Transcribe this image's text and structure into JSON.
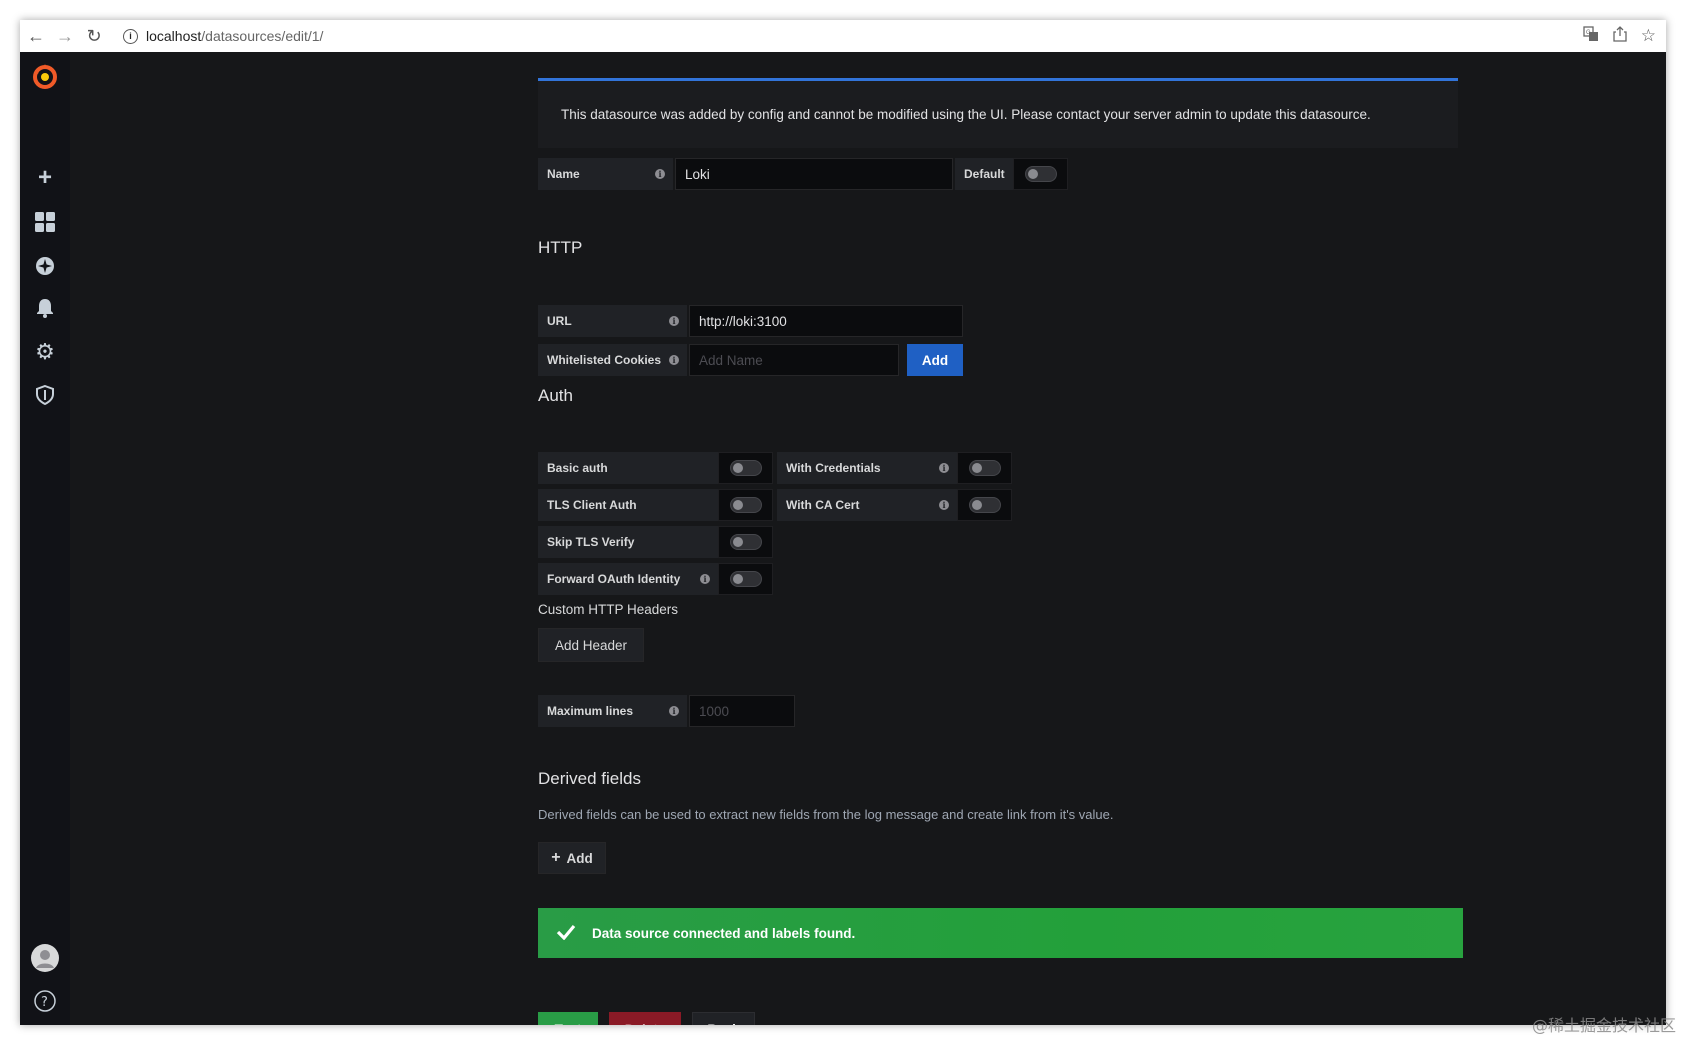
{
  "browser": {
    "url_host": "localhost",
    "url_path": "/datasources/edit/1/"
  },
  "alert_info": "This datasource was added by config and cannot be modified using the UI. Please contact your server admin to update this datasource.",
  "name_row": {
    "label": "Name",
    "value": "Loki",
    "default_label": "Default"
  },
  "http": {
    "title": "HTTP",
    "url_label": "URL",
    "url_value": "http://loki:3100",
    "cookies_label": "Whitelisted Cookies",
    "cookies_placeholder": "Add Name",
    "add_label": "Add"
  },
  "auth": {
    "title": "Auth",
    "basic_auth": "Basic auth",
    "with_credentials": "With Credentials",
    "tls_client_auth": "TLS Client Auth",
    "with_ca_cert": "With CA Cert",
    "skip_tls_verify": "Skip TLS Verify",
    "forward_oauth": "Forward OAuth Identity"
  },
  "custom_headers": {
    "title": "Custom HTTP Headers",
    "add_header": "Add Header"
  },
  "max_lines": {
    "label": "Maximum lines",
    "placeholder": "1000"
  },
  "derived_fields": {
    "title": "Derived fields",
    "description": "Derived fields can be used to extract new fields from the log message and create link from it's value.",
    "add": "Add"
  },
  "alert_success": "Data source connected and labels found.",
  "actions": {
    "test": "Test",
    "delete": "Delete",
    "back": "Back"
  },
  "watermark": "@稀土掘金技术社区",
  "colors": {
    "primary": "#1f60c4",
    "success": "#299c46",
    "danger": "#8a1a26",
    "info_border": "#3274d9"
  }
}
